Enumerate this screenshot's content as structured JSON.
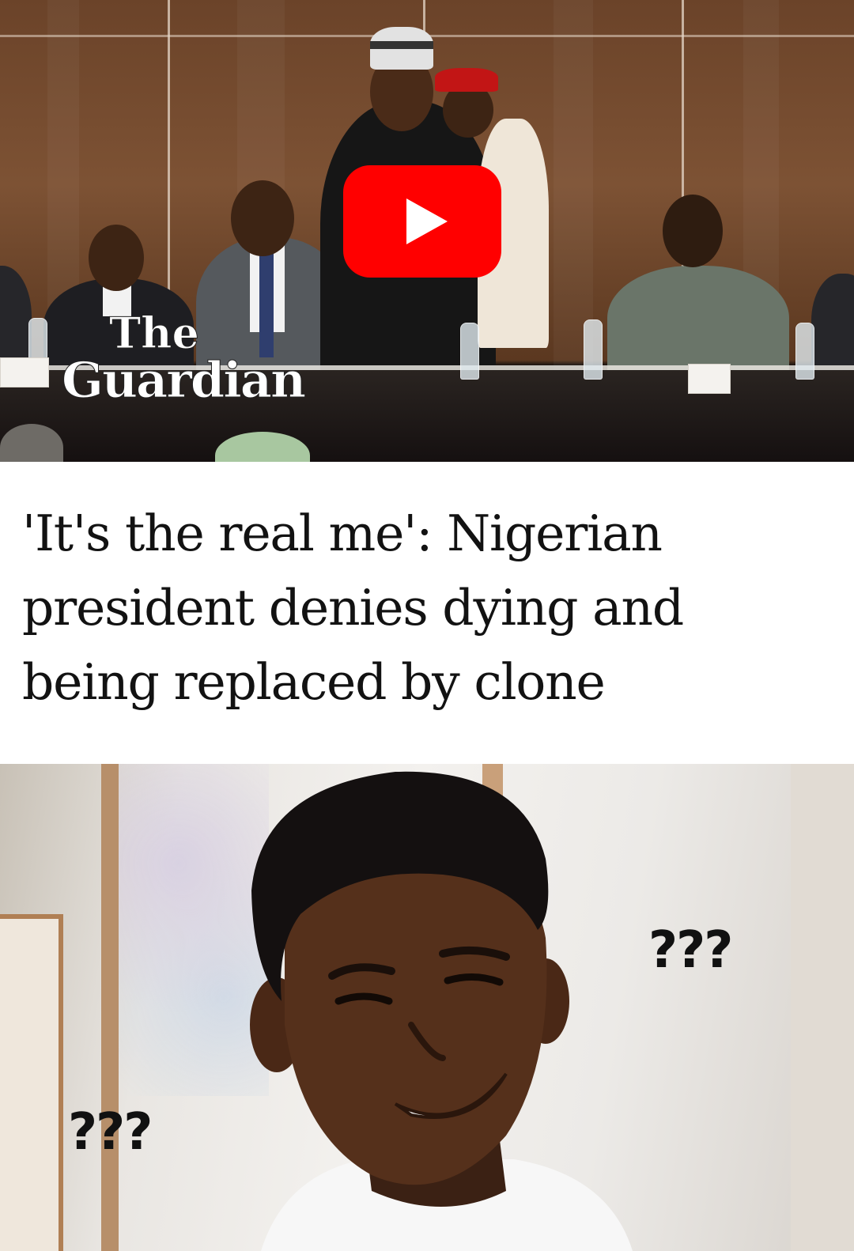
{
  "video": {
    "logo_lines": [
      "The",
      "Guardian"
    ],
    "play_icon": "youtube-play-icon",
    "play_button_color": "#ff0000"
  },
  "headline": "'It's the real me': Nigerian president denies dying and being replaced by clone",
  "meme": {
    "question_marks_right": "???",
    "question_marks_left": "???"
  }
}
